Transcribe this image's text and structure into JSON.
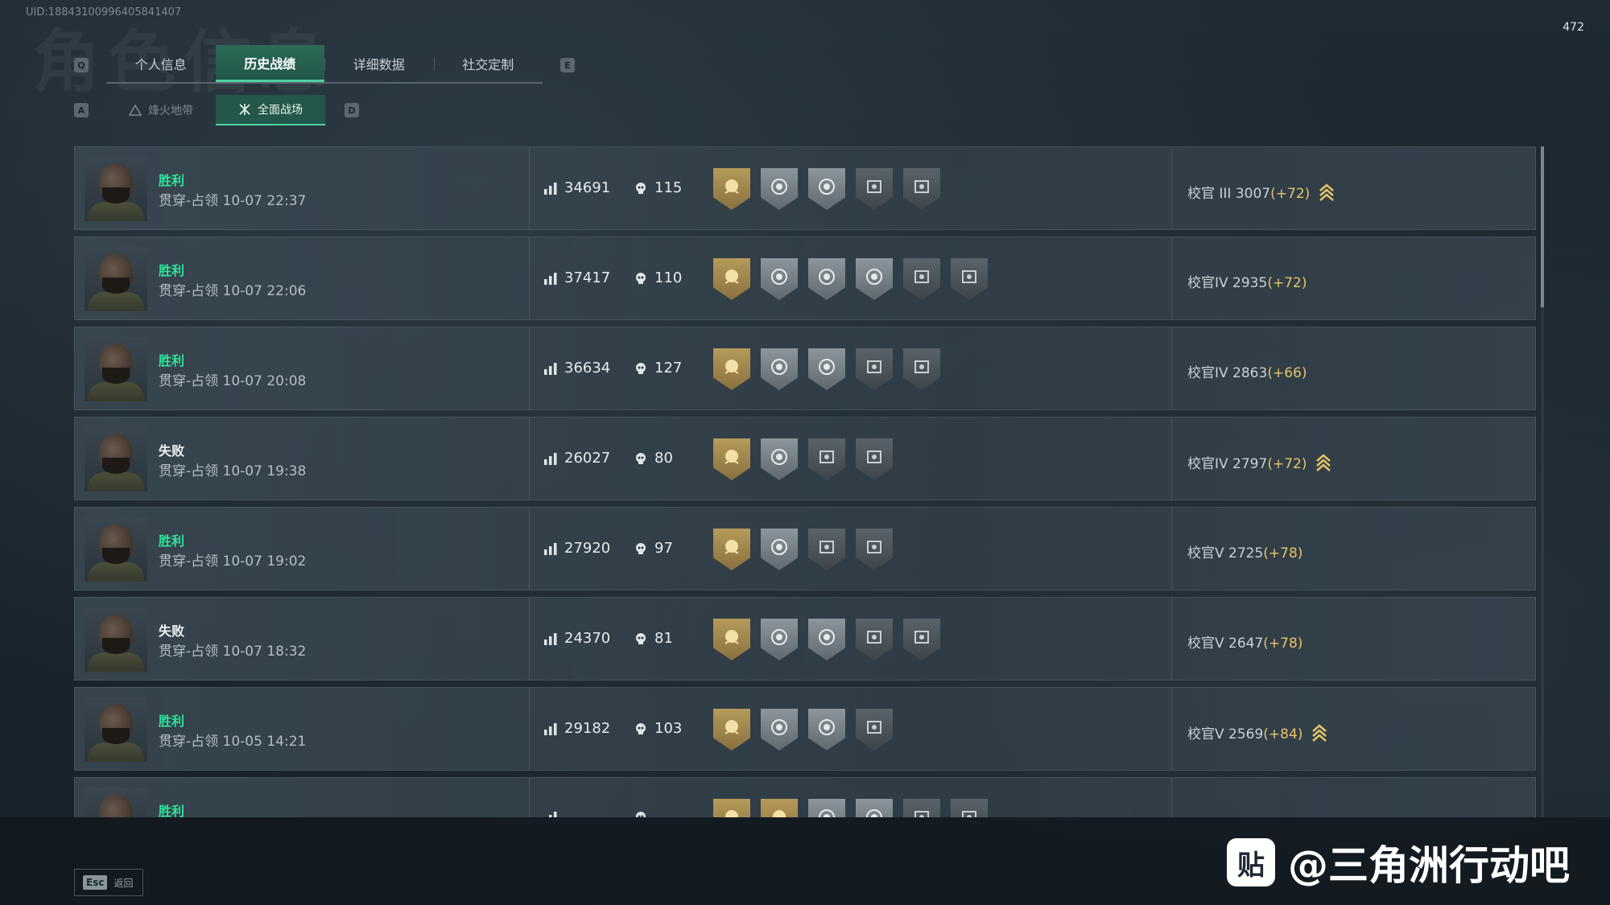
{
  "header": {
    "uid": "UID:18843100996405841407",
    "bg_title": "角色信息",
    "corner_number": "472"
  },
  "tabs": {
    "left_key": "Q",
    "right_key": "E",
    "items": [
      {
        "label": "个人信息",
        "active": false
      },
      {
        "label": "历史战绩",
        "active": true
      },
      {
        "label": "详细数据",
        "active": false
      },
      {
        "label": "社交定制",
        "active": false
      }
    ]
  },
  "subtabs": {
    "left_key": "A",
    "right_key": "D",
    "items": [
      {
        "label": "烽火地带",
        "active": false
      },
      {
        "label": "全面战场",
        "active": true
      }
    ]
  },
  "matches": [
    {
      "result": "胜利",
      "win": true,
      "mode": "贯穿-占领 10-07 22:37",
      "score": "34691",
      "kills": "115",
      "medals": [
        "gold",
        "silver",
        "silver",
        "dark",
        "dark"
      ],
      "rank": "校官 III 3007",
      "delta": "(+72)",
      "rank_up": true
    },
    {
      "result": "胜利",
      "win": true,
      "mode": "贯穿-占领 10-07 22:06",
      "score": "37417",
      "kills": "110",
      "medals": [
        "gold",
        "silver",
        "silver",
        "silver",
        "dark",
        "dark"
      ],
      "rank": "校官IV 2935",
      "delta": "(+72)",
      "rank_up": false
    },
    {
      "result": "胜利",
      "win": true,
      "mode": "贯穿-占领 10-07 20:08",
      "score": "36634",
      "kills": "127",
      "medals": [
        "gold",
        "silver",
        "silver",
        "dark",
        "dark"
      ],
      "rank": "校官IV 2863",
      "delta": "(+66)",
      "rank_up": false
    },
    {
      "result": "失败",
      "win": false,
      "mode": "贯穿-占领 10-07 19:38",
      "score": "26027",
      "kills": "80",
      "medals": [
        "gold",
        "silver",
        "dark",
        "dark"
      ],
      "rank": "校官IV 2797",
      "delta": "(+72)",
      "rank_up": true
    },
    {
      "result": "胜利",
      "win": true,
      "mode": "贯穿-占领 10-07 19:02",
      "score": "27920",
      "kills": "97",
      "medals": [
        "gold",
        "silver",
        "dark",
        "dark"
      ],
      "rank": "校官V 2725",
      "delta": "(+78)",
      "rank_up": false
    },
    {
      "result": "失败",
      "win": false,
      "mode": "贯穿-占领 10-07 18:32",
      "score": "24370",
      "kills": "81",
      "medals": [
        "gold",
        "silver",
        "silver",
        "dark",
        "dark"
      ],
      "rank": "校官V 2647",
      "delta": "(+78)",
      "rank_up": false
    },
    {
      "result": "胜利",
      "win": true,
      "mode": "贯穿-占领 10-05 14:21",
      "score": "29182",
      "kills": "103",
      "medals": [
        "gold",
        "silver",
        "silver",
        "dark"
      ],
      "rank": "校官V 2569",
      "delta": "(+84)",
      "rank_up": true
    },
    {
      "result": "胜利",
      "win": true,
      "mode": "",
      "score": "",
      "kills": "",
      "medals": [
        "gold",
        "gold",
        "silver",
        "silver",
        "dark",
        "dark"
      ],
      "rank": "",
      "delta": "",
      "rank_up": false
    }
  ],
  "footer": {
    "esc_key": "Esc",
    "back_label": "返回"
  },
  "watermark": {
    "logo_char": "贴",
    "text": "@三角洲行动吧"
  },
  "colors": {
    "win": "#2fe39b",
    "accent": "#4fd1a1",
    "delta": "#e6c468",
    "rank_up": "#e6c468"
  }
}
